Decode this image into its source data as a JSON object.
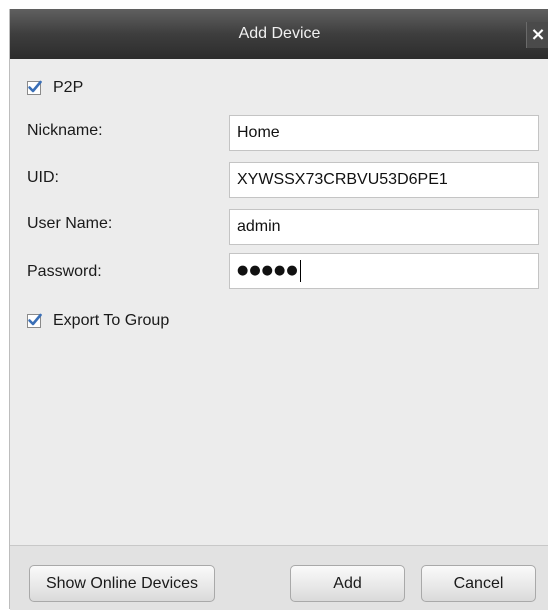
{
  "window": {
    "title": "Add Device",
    "close_glyph": "×"
  },
  "p2p": {
    "label": "P2P",
    "checked": true
  },
  "form": {
    "nickname": {
      "label": "Nickname:",
      "value": "Home"
    },
    "uid": {
      "label": "UID:",
      "value": "XYWSSX73CRBVU53D6PE1"
    },
    "username": {
      "label": "User Name:",
      "value": "admin"
    },
    "password": {
      "label": "Password:",
      "masked_value": "●●●●●"
    }
  },
  "export_group": {
    "label": "Export To Group",
    "checked": true
  },
  "buttons": {
    "show_online": "Show Online Devices",
    "add": "Add",
    "cancel": "Cancel"
  },
  "colors": {
    "checkmark": "#3a6fb7",
    "titlebar": "#3e3e3e"
  }
}
